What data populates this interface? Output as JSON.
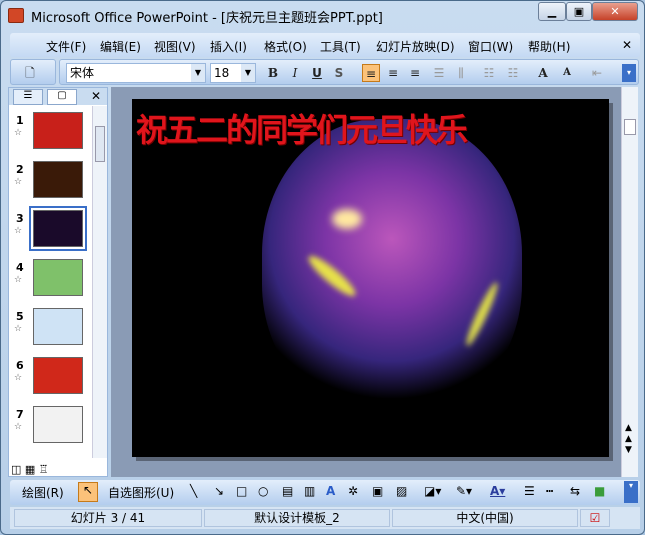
{
  "window": {
    "title": "Microsoft Office PowerPoint - [庆祝元旦主题班会PPT.ppt]"
  },
  "menu": [
    "文件(F)",
    "编辑(E)",
    "视图(V)",
    "插入(I)",
    "格式(O)",
    "工具(T)",
    "幻灯片放映(D)",
    "窗口(W)",
    "帮助(H)"
  ],
  "format": {
    "font": "宋体",
    "size": "18",
    "bold": "B",
    "italic": "I",
    "underline": "U",
    "shadow": "S",
    "grow": "A",
    "shrink": "A"
  },
  "slides": [
    {
      "n": "1",
      "color": "#c8201a"
    },
    {
      "n": "2",
      "color": "#3a1a08"
    },
    {
      "n": "3",
      "color": "#1a0a2a"
    },
    {
      "n": "4",
      "color": "#7fc16a"
    },
    {
      "n": "5",
      "color": "#cfe3f5"
    },
    {
      "n": "6",
      "color": "#d0281a"
    },
    {
      "n": "7",
      "color": "#f2f2f2"
    }
  ],
  "slide": {
    "title": "祝五二的同学们元旦快乐"
  },
  "draw": {
    "draw_label": "绘图(R)",
    "autoshapes_label": "自选图形(U)"
  },
  "status": {
    "slide": "幻灯片 3 / 41",
    "template": "默认设计模板_2",
    "language": "中文(中国)"
  }
}
